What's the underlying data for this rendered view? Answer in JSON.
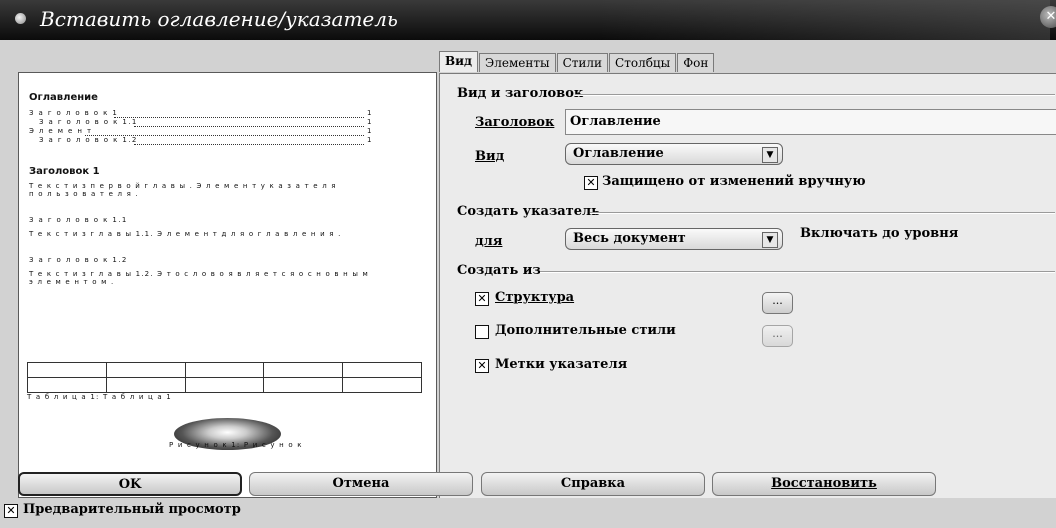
{
  "window": {
    "title": "Вставить оглавление/указатель"
  },
  "preview": {
    "toc_title": "Оглавление",
    "toc_entries": [
      {
        "text": "З а г о л о в о к  1",
        "page": "1"
      },
      {
        "text": "З а г о л о в о к  1.1",
        "page": "1"
      },
      {
        "text": "Э л е м е н т",
        "page": "1"
      },
      {
        "text": "З а г о л о в о к  1.2",
        "page": "1"
      }
    ],
    "heading1": "Заголовок 1",
    "text1": "Т е к с т  и з  п е р в о й  г л а в ы .  Э л е м е н т  у к а з а т е л я",
    "text1b": "п о л ь з о в а т е л я .",
    "heading11": "З а г о л о в о к  1.1",
    "text11": "Т е к с т  и з  г л а в ы  1.1.  Э л е м е н т  д л я  о г л а в л е н и я .",
    "heading12": "З а г о л о в о к  1.2",
    "text12": "Т е к с т  и з  г л а в ы  1.2.  Э т о  с л о в о  я в л я е т с я  о с н о в н ы м",
    "text12b": "э л е м е н т о м .",
    "table_caption": "Т а б л и ц а  1: Т а б л и ц а  1",
    "image_caption": "Р и с у н о к  1: Р и с у н о к"
  },
  "tabs": [
    "Вид",
    "Элементы",
    "Стили",
    "Столбцы",
    "Фон"
  ],
  "active_tab": "Вид",
  "view_section": {
    "group_label": "Вид и заголовок",
    "title_label": "Заголовок",
    "title_value": "Оглавление",
    "type_label": "Вид",
    "type_value": "Оглавление",
    "protected_label": "Защищено от изменений вручную",
    "protected_checked": true
  },
  "create_index": {
    "group_label": "Создать указатель",
    "for_label": "для",
    "for_value": "Весь документ",
    "level_label": "Включать до уровня"
  },
  "create_from": {
    "group_label": "Создать из",
    "structure_label": "Структура",
    "structure_checked": true,
    "extra_styles_label": "Дополнительные стили",
    "extra_styles_checked": false,
    "index_marks_label": "Метки указателя",
    "index_marks_checked": true,
    "dots": "..."
  },
  "buttons": {
    "ok": "OK",
    "cancel": "Отмена",
    "help": "Справка",
    "reset": "Восстановить"
  },
  "preview_checkbox": {
    "label": "Предварительный просмотр",
    "checked": true
  }
}
